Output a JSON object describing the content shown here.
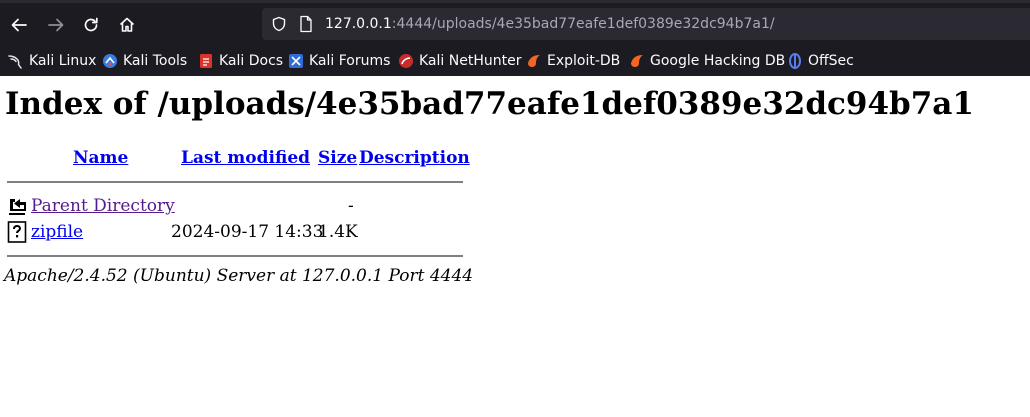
{
  "browser": {
    "url": {
      "host": "127.0.0.1",
      "rest": ":4444/uploads/4e35bad77eafe1def0389e32dc94b7a1/"
    },
    "bookmarks": [
      {
        "label": "Kali Linux",
        "icon": "kali-dragon-icon"
      },
      {
        "label": "Kali Tools",
        "icon": "kali-tools-icon"
      },
      {
        "label": "Kali Docs",
        "icon": "kali-docs-icon"
      },
      {
        "label": "Kali Forums",
        "icon": "kali-forums-icon"
      },
      {
        "label": "Kali NetHunter",
        "icon": "nethunter-icon"
      },
      {
        "label": "Exploit-DB",
        "icon": "exploit-db-icon"
      },
      {
        "label": "Google Hacking DB",
        "icon": "ghdb-icon"
      },
      {
        "label": "OffSec",
        "icon": "offsec-icon"
      }
    ],
    "colors": {
      "chrome": "#1c1b22",
      "urlbar": "#2b2a33",
      "text": "#fbfbfe"
    }
  },
  "listing": {
    "title": "Index of /uploads/4e35bad77eafe1def0389e32dc94b7a1",
    "columns": {
      "name": "Name",
      "last_modified": "Last modified",
      "size": "Size",
      "description": "Description"
    },
    "rows": [
      {
        "icon": "back-arrow-icon",
        "name": "Parent Directory",
        "last_modified": "",
        "size": "-",
        "description": ""
      },
      {
        "icon": "unknown-file-icon",
        "name": "zipfile",
        "last_modified": "2024-09-17 14:33",
        "size": "1.4K",
        "description": ""
      }
    ],
    "footer": "Apache/2.4.52 (Ubuntu) Server at 127.0.0.1 Port 4444",
    "colors": {
      "link": "#0000ee",
      "visited": "#551a8b"
    }
  }
}
